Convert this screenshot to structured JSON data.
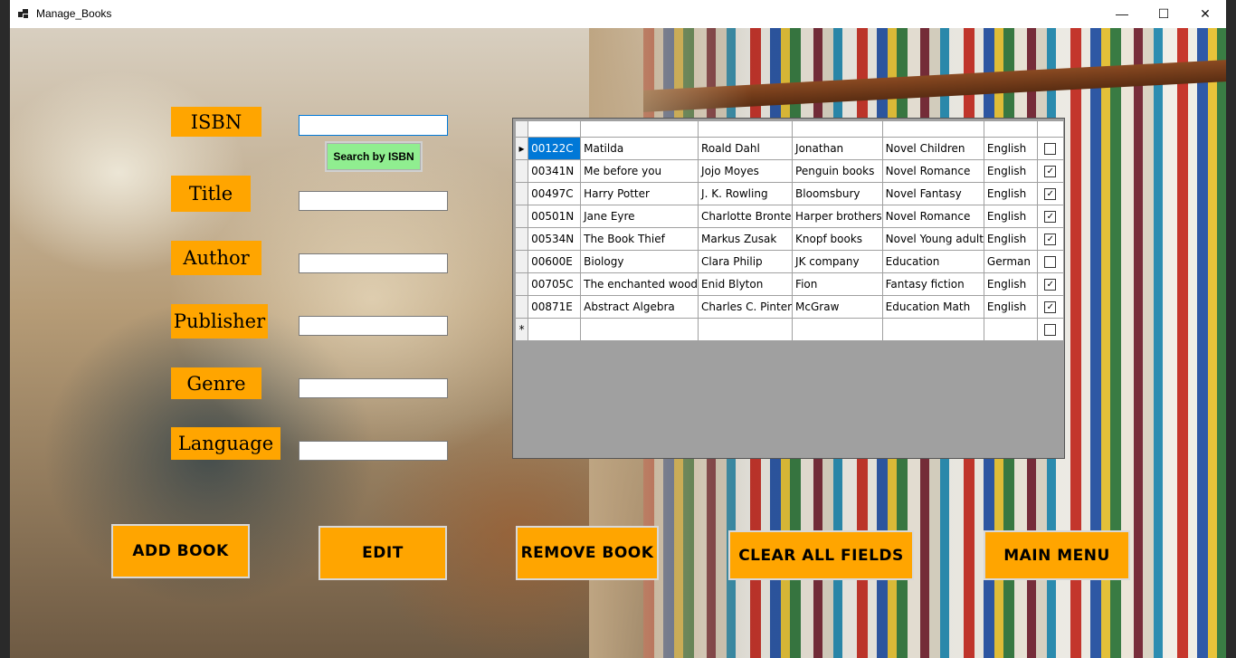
{
  "window": {
    "title": "Manage_Books",
    "minimize_glyph": "—",
    "maximize_glyph": "☐",
    "close_glyph": "✕"
  },
  "form": {
    "labels": {
      "isbn": "ISBN",
      "title": "Title",
      "author": "Author",
      "publisher": "Publisher",
      "genre": "Genre",
      "language": "Language"
    },
    "values": {
      "isbn": "",
      "title": "",
      "author": "",
      "publisher": "",
      "genre": "",
      "language": ""
    },
    "search_button": "Search by ISBN"
  },
  "grid": {
    "headers": [
      "",
      "",
      "",
      "",
      "",
      "",
      ""
    ],
    "row_indicator": "▸",
    "new_row_indicator": "*",
    "rows": [
      {
        "cells": [
          "00122C",
          "Matilda",
          "Roald Dahl",
          "Jonathan",
          "Novel Children",
          "English"
        ],
        "checked": false
      },
      {
        "cells": [
          "00341N",
          "Me before you",
          "Jojo Moyes",
          "Penguin books",
          "Novel Romance",
          "English"
        ],
        "checked": true
      },
      {
        "cells": [
          "00497C",
          "Harry Potter",
          "J. K. Rowling",
          "Bloomsbury",
          "Novel Fantasy",
          "English"
        ],
        "checked": true
      },
      {
        "cells": [
          "00501N",
          "Jane Eyre",
          "Charlotte Bronte",
          "Harper brothers",
          "Novel Romance",
          "English"
        ],
        "checked": true
      },
      {
        "cells": [
          "00534N",
          "The Book Thief",
          "Markus Zusak",
          "Knopf books",
          "Novel Young adult",
          "English"
        ],
        "checked": true
      },
      {
        "cells": [
          "00600E",
          "Biology",
          "Clara Philip",
          "JK company",
          "Education",
          "German"
        ],
        "checked": false
      },
      {
        "cells": [
          "00705C",
          "The enchanted wood",
          "Enid Blyton",
          "Fion",
          "Fantasy fiction",
          "English"
        ],
        "checked": true
      },
      {
        "cells": [
          "00871E",
          "Abstract Algebra",
          "Charles C. Pinter",
          "McGraw",
          "Education Math",
          "English"
        ],
        "checked": true
      }
    ]
  },
  "actions": {
    "add": "ADD BOOK",
    "edit": "EDIT",
    "remove": "REMOVE BOOK",
    "clear": "CLEAR ALL FIELDS",
    "main_menu": "MAIN MENU"
  },
  "colors": {
    "label_bg": "#ffa500",
    "search_bg": "#90ee90",
    "selection": "#0078d7"
  }
}
